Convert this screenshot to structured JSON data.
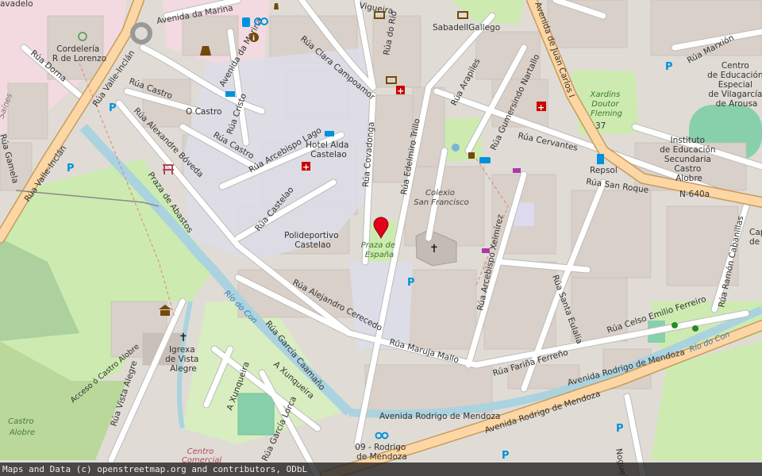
{
  "attribution": "Maps and Data (c) openstreetmap.org and contributors, ODbL",
  "marker": {
    "label": "Praza de España"
  },
  "streets": {
    "avenida_da_marina_1": "Avenida da Marina",
    "avenida_da_marina_2": "Avenida da Marina",
    "vigueira": "Vigueira",
    "rua_do_rio": "Rúa do Río",
    "rua_clara_campoamor": "Rúa Clara Campoamor",
    "rua_valle_inclan_1": "Rúa Valle-Inclán",
    "rua_valle_inclan_2": "Rúa Valle-Inclán",
    "rua_dorna": "Rúa Dorna",
    "rua_castro_1": "Rúa Castro",
    "rua_castro_2": "Rúa Castro",
    "o_castro": "O Castro",
    "rua_cristo": "Rúa Cristo",
    "rua_arcebispo_lago": "Rúa Arcebispo Lago",
    "rua_alexandre_boveda": "Rúa Alexandre Bóveda",
    "praza_de_abastos": "Praza de Abastos",
    "rua_castelao": "Rúa Castelao",
    "rua_covadonga": "Rúa Covadonga",
    "rua_edelmiro_trillo": "Rúa Edelmiro Trillo",
    "rua_arapiles": "Rúa Arapiles",
    "rua_gumersindo_nartallo": "Rúa Gumersindo Nartallo",
    "avenida_juan_carlos": "Avenida de Juan Carlos I",
    "rua_marxion": "Rúa Marxión",
    "rua_cervantes": "Rúa Cervantes",
    "rua_san_roque": "Rúa San Roque",
    "n640a": "N-640a",
    "rua_arcebispo_xelmirez": "Rúa Arcebispo Xelmírez",
    "rua_santa_eulalia": "Rúa Santa Eulalia",
    "rua_ramon_cabanillas": "Rúa Ramón Cabanillas",
    "rua_celso_emilio": "Rúa Celso Emilio Ferreiro",
    "rua_alejandro_cerecedo": "Rúa Alejandro Cerecedo",
    "rua_maruja_mallo": "Rúa Maruja Mallo",
    "rua_farina_ferreno": "Rúa Fariña Ferreño",
    "avenida_rodrigo_1": "Avenida Rodrigo de Mendoza",
    "avenida_rodrigo_2": "Avenida Rodrigo de Mendoza",
    "avenida_rodrigo_3": "Avenida Rodrigo de Mendoza",
    "rua_garcia_caamano": "Rúa García Caamaño",
    "a_xunqueira_1": "A Xunqueira",
    "a_xunqueira_2": "A Xunqueira",
    "rua_garcia_lorca": "Rúa García Lorca",
    "rua_vista_alegre": "Rúa Vista Alegre",
    "acceso_castro": "Acceso ó Castro Alobre",
    "rio_con_1": "Río do Con",
    "rio_con_2": "Río do Con",
    "nogueira": "Nogueira",
    "rua_gamelas": "Rúa Gamela",
    "avadelo": "avadelo",
    "saines": "Saínes"
  },
  "places": {
    "cordeleria": [
      "Cordelería",
      "R de Lorenzo"
    ],
    "sabadell": "SabadellGallego",
    "hotel_alda": [
      "Hotel Alda",
      "Castelao"
    ],
    "colexio": [
      "Colexio",
      "San Francisco"
    ],
    "polideportivo": [
      "Polideportivo",
      "Castelao"
    ],
    "praza_espana": [
      "Praza de",
      "España"
    ],
    "xardins": [
      "Xardíns",
      "Doutor",
      "Fleming"
    ],
    "centro_educacion": [
      "Centro",
      "de Educación",
      "Especial",
      "de Vilagarcía",
      "de Arousa"
    ],
    "instituto": [
      "Instituto",
      "de Educación",
      "Secundaria",
      "Castro",
      "Alobre"
    ],
    "repsol": "Repsol",
    "igrexa": [
      "Igrexa",
      "de Vista",
      "Alegre"
    ],
    "castro_alobre": [
      "Castro",
      "Alobre"
    ],
    "bus_stop": [
      "09 - Rodrigo",
      "de Mendoza"
    ],
    "centro_comercial": [
      "Centro",
      "Comercial"
    ],
    "n37": "37",
    "cap": [
      "Cap",
      "de"
    ]
  },
  "icons": {
    "parking": "P",
    "church": "✝",
    "info": "i",
    "fuel": "fuel-pump",
    "pharmacy": "+",
    "bank": "bank",
    "taxi": "taxi"
  },
  "colors": {
    "background": "#f2efe9",
    "building": "#d9d0c9",
    "road": "#ffffff",
    "primary_road": "#fcd6a4",
    "primary_casing": "#c99b5b",
    "park": "#cdebb0",
    "grass": "#d8eec0",
    "water": "#aad3df",
    "pedestrian": "#dddde8",
    "residential_pink": "#f2dae0",
    "marker": "#e3001b"
  }
}
